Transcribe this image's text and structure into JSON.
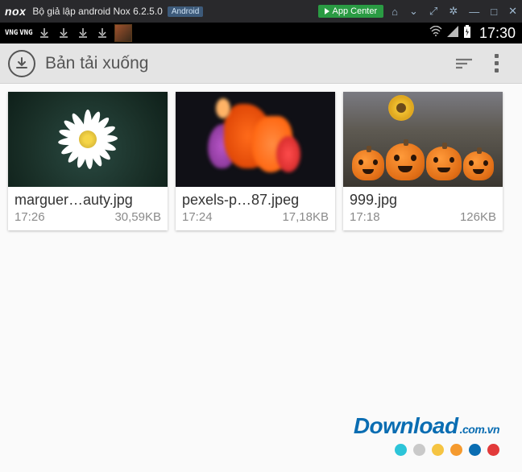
{
  "window": {
    "logo": "nox",
    "title": "Bộ giả lập android Nox 6.2.5.0",
    "badge": "Android",
    "app_center": "App Center"
  },
  "status": {
    "time": "17:30"
  },
  "app": {
    "title": "Bản tải xuống"
  },
  "downloads": [
    {
      "name": "marguer…auty.jpg",
      "time": "17:26",
      "size": "30,59KB"
    },
    {
      "name": "pexels-p…87.jpeg",
      "time": "17:24",
      "size": "17,18KB"
    },
    {
      "name": "999.jpg",
      "time": "17:18",
      "size": "126KB"
    }
  ],
  "watermark": {
    "main": "Download",
    "suffix": ".com.vn"
  }
}
